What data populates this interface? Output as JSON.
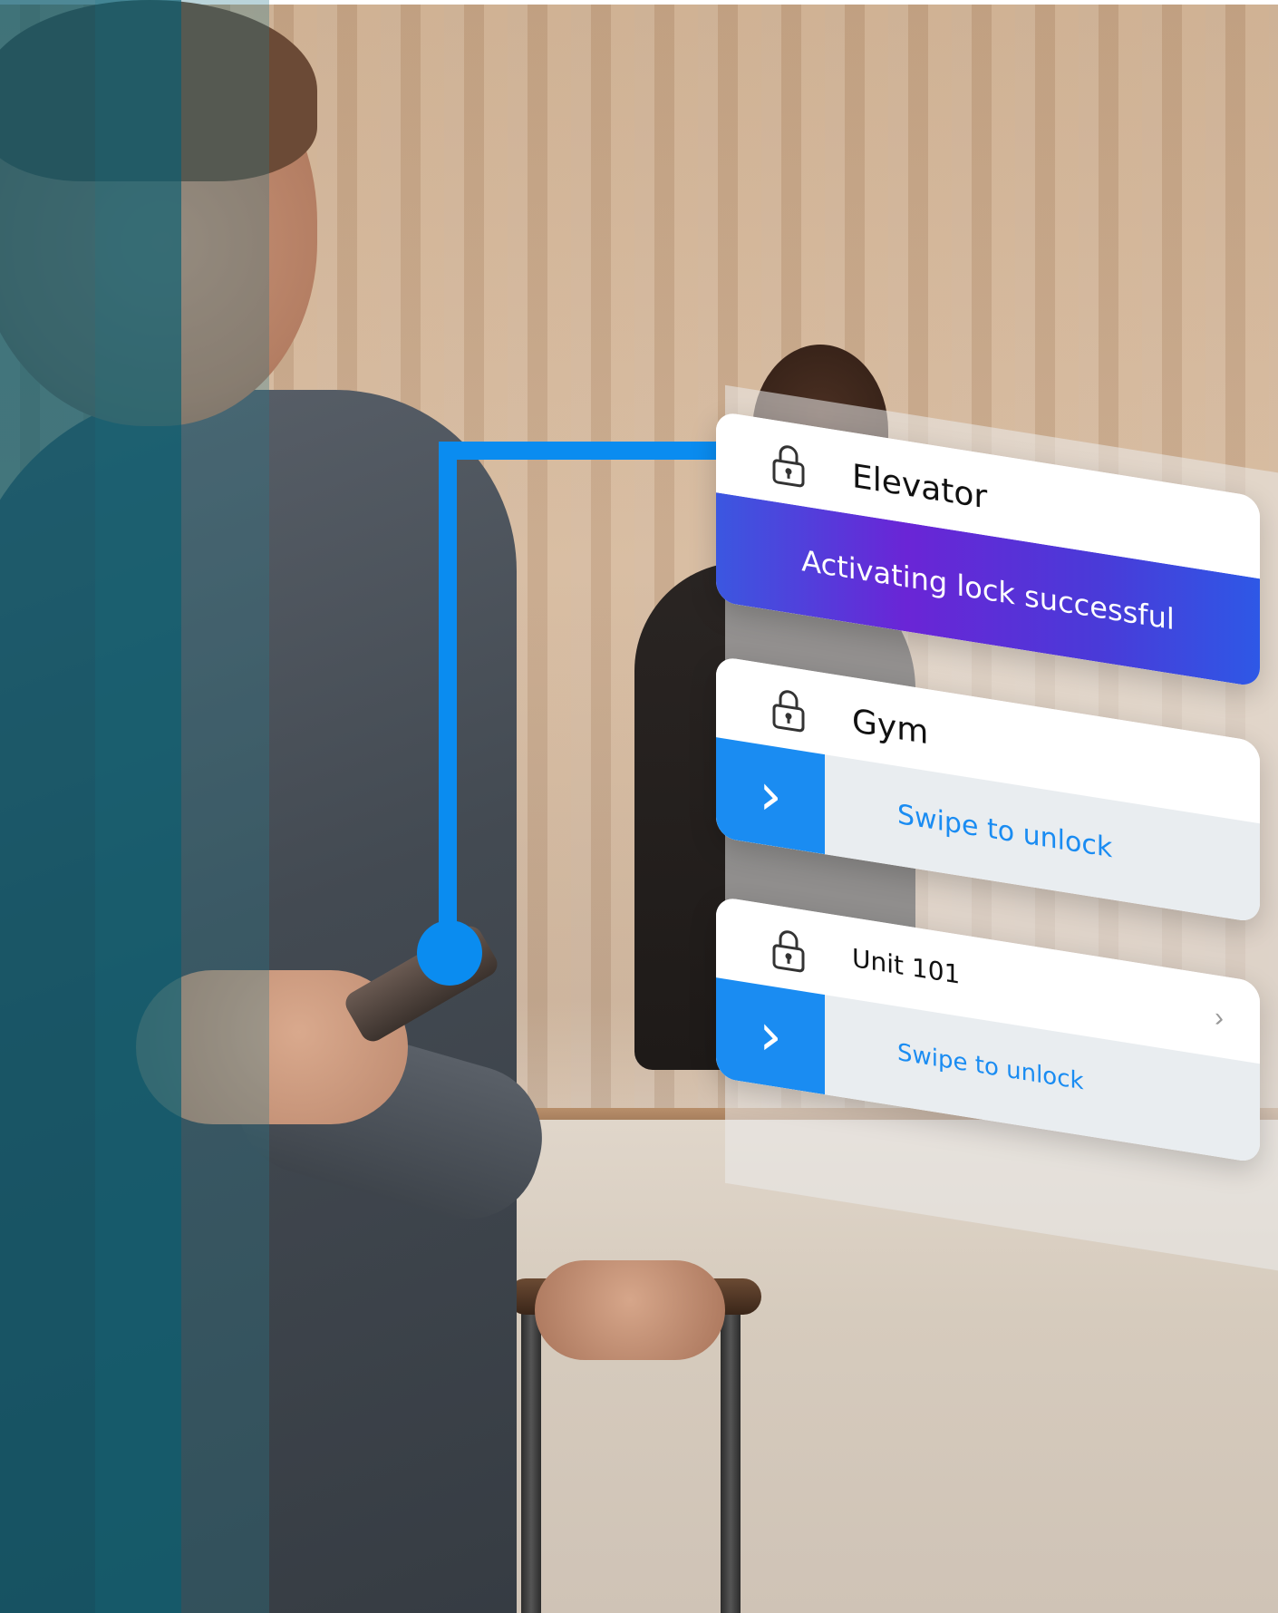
{
  "colors": {
    "accent_blue": "#1a8cf2",
    "connector_blue": "#0a8cf0",
    "success_gradient_start": "#3b57e0",
    "success_gradient_mid": "#6a25d6",
    "teal_overlay": "#0a5a6e"
  },
  "locks": [
    {
      "title": "Elevator",
      "icon": "lock-icon",
      "status": "Activating lock successful"
    },
    {
      "title": "Gym",
      "icon": "lock-icon",
      "swipe_label": "Swipe to unlock",
      "swipe_icon": "chevron-right-icon"
    },
    {
      "title": "Unit 101",
      "icon": "lock-icon",
      "swipe_label": "Swipe to unlock",
      "swipe_icon": "chevron-right-icon",
      "row_icon": "chevron-right-icon"
    }
  ]
}
